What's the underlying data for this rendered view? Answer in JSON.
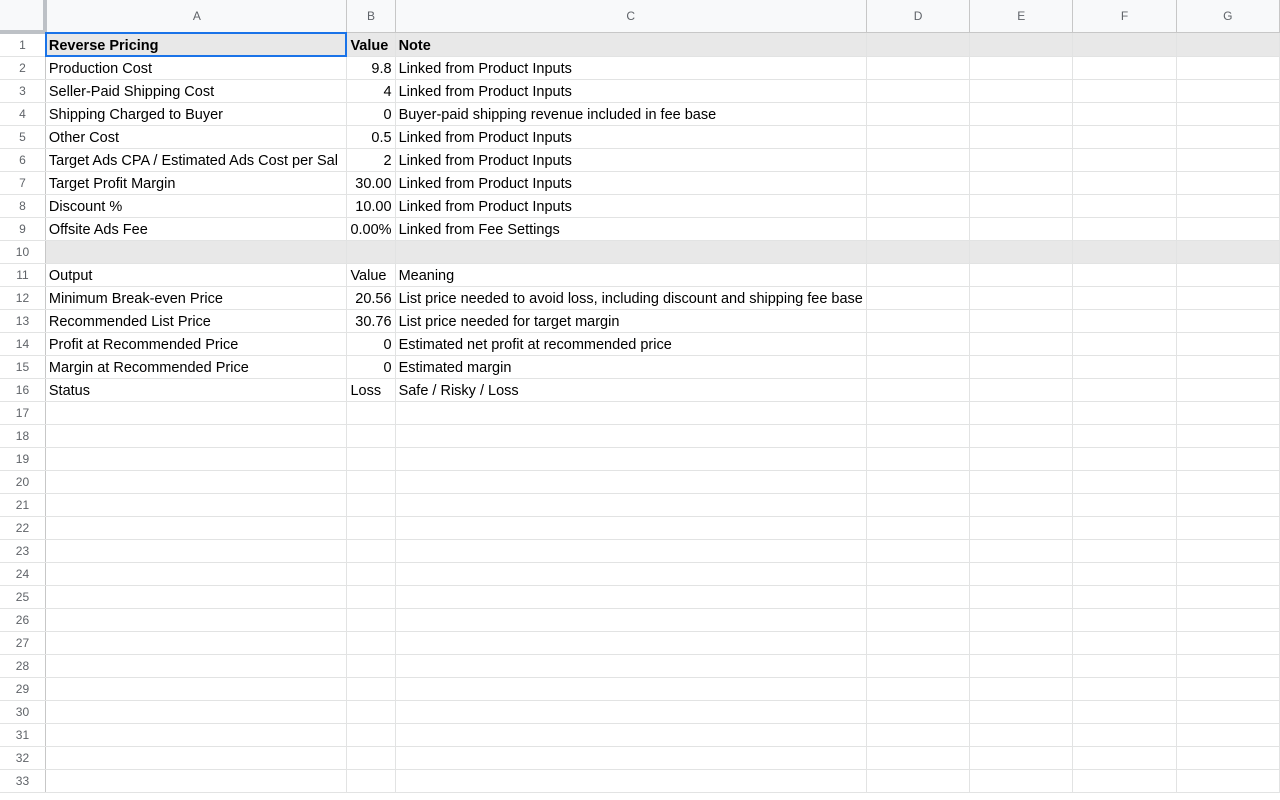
{
  "columns": [
    "A",
    "B",
    "C",
    "D",
    "E",
    "F",
    "G"
  ],
  "rows": [
    {
      "num": "1",
      "a": "Reverse Pricing",
      "b": "Value",
      "c": "Note"
    },
    {
      "num": "2",
      "a": "Production Cost",
      "b": "9.8",
      "c": "Linked from Product Inputs"
    },
    {
      "num": "3",
      "a": "Seller-Paid Shipping Cost",
      "b": "4",
      "c": "Linked from Product Inputs"
    },
    {
      "num": "4",
      "a": "Shipping Charged to Buyer",
      "b": "0",
      "c": "Buyer-paid shipping revenue included in fee base"
    },
    {
      "num": "5",
      "a": "Other Cost",
      "b": "0.5",
      "c": "Linked from Product Inputs"
    },
    {
      "num": "6",
      "a": "Target Ads CPA / Estimated Ads Cost per Sal",
      "b": "2",
      "c": "Linked from Product Inputs"
    },
    {
      "num": "7",
      "a": "Target Profit Margin",
      "b": "30.00",
      "c": "Linked from Product Inputs"
    },
    {
      "num": "8",
      "a": "Discount %",
      "b": "10.00",
      "c": "Linked from Product Inputs"
    },
    {
      "num": "9",
      "a": "Offsite Ads Fee",
      "b": "0.00%",
      "c": "Linked from Fee Settings"
    },
    {
      "num": "10",
      "a": "",
      "b": "",
      "c": ""
    },
    {
      "num": "11",
      "a": "Output",
      "b": "Value",
      "c": "Meaning"
    },
    {
      "num": "12",
      "a": "Minimum Break-even Price",
      "b": "20.56",
      "c": "List price needed to avoid loss, including discount and shipping fee base"
    },
    {
      "num": "13",
      "a": "Recommended List Price",
      "b": "30.76",
      "c": "List price needed for target margin"
    },
    {
      "num": "14",
      "a": "Profit at Recommended Price",
      "b": "0",
      "c": "Estimated net profit at recommended price"
    },
    {
      "num": "15",
      "a": "Margin at Recommended Price",
      "b": "0",
      "c": "Estimated margin"
    },
    {
      "num": "16",
      "a": "Status",
      "b": "Loss",
      "c": "Safe / Risky / Loss"
    },
    {
      "num": "17",
      "a": "",
      "b": "",
      "c": ""
    },
    {
      "num": "18",
      "a": "",
      "b": "",
      "c": ""
    },
    {
      "num": "19",
      "a": "",
      "b": "",
      "c": ""
    },
    {
      "num": "20",
      "a": "",
      "b": "",
      "c": ""
    },
    {
      "num": "21",
      "a": "",
      "b": "",
      "c": ""
    },
    {
      "num": "22",
      "a": "",
      "b": "",
      "c": ""
    },
    {
      "num": "23",
      "a": "",
      "b": "",
      "c": ""
    },
    {
      "num": "24",
      "a": "",
      "b": "",
      "c": ""
    },
    {
      "num": "25",
      "a": "",
      "b": "",
      "c": ""
    },
    {
      "num": "26",
      "a": "",
      "b": "",
      "c": ""
    },
    {
      "num": "27",
      "a": "",
      "b": "",
      "c": ""
    },
    {
      "num": "28",
      "a": "",
      "b": "",
      "c": ""
    },
    {
      "num": "29",
      "a": "",
      "b": "",
      "c": ""
    },
    {
      "num": "30",
      "a": "",
      "b": "",
      "c": ""
    },
    {
      "num": "31",
      "a": "",
      "b": "",
      "c": ""
    },
    {
      "num": "32",
      "a": "",
      "b": "",
      "c": ""
    },
    {
      "num": "33",
      "a": "",
      "b": "",
      "c": ""
    }
  ],
  "colors": {
    "selection": "#1a73e8",
    "shaded_row": "#e8e8e8",
    "header_bg": "#f8f9fa",
    "gridline": "#e2e3e3"
  }
}
